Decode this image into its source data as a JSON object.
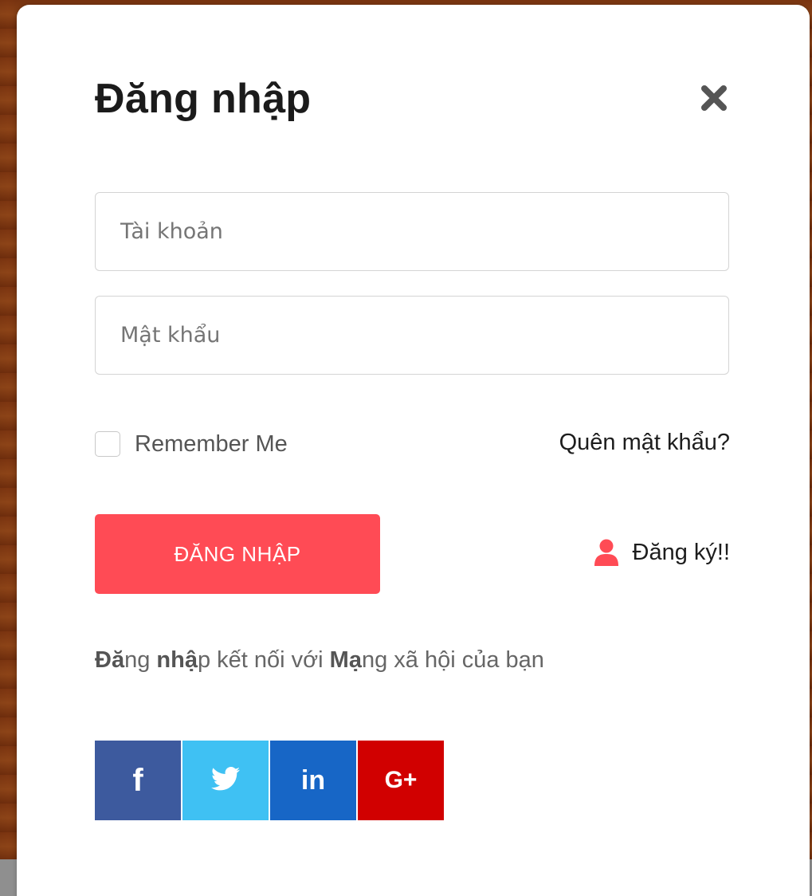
{
  "modal": {
    "title": "Đăng nhập",
    "close_icon": "close-icon"
  },
  "form": {
    "username_placeholder": "Tài khoản",
    "username_value": "",
    "password_placeholder": "Mật khẩu",
    "password_value": "",
    "remember_label": "Remember Me",
    "remember_checked": false,
    "forgot_label": "Quên mật khẩu?",
    "login_button_label": "ĐĂNG NHẬP",
    "register_label": "Đăng ký!!",
    "register_icon": "user-icon"
  },
  "social": {
    "prompt_parts": [
      "Đă",
      "ng ",
      "nhậ",
      "p kết nối với ",
      "Mạ",
      "ng xã hội của bạn"
    ],
    "buttons": [
      {
        "name": "facebook",
        "label": "f",
        "icon": "facebook-icon",
        "color": "#3d5a9e"
      },
      {
        "name": "twitter",
        "label": "",
        "icon": "twitter-icon",
        "color": "#3fc1f3"
      },
      {
        "name": "linkedin",
        "label": "in",
        "icon": "linkedin-icon",
        "color": "#1766c6"
      },
      {
        "name": "google-plus",
        "label": "G+",
        "icon": "google-plus-icon",
        "color": "#d10000"
      }
    ]
  },
  "colors": {
    "accent": "#ff4b55",
    "title": "#1b1b1b",
    "muted_text": "#666666"
  }
}
